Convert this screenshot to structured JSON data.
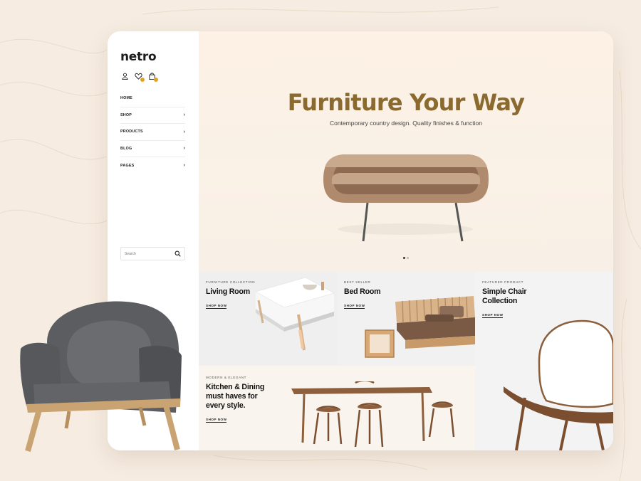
{
  "brand": {
    "logo": "netro"
  },
  "header_icons": [
    "user-icon",
    "heart-icon",
    "bag-icon"
  ],
  "nav": {
    "items": [
      {
        "label": "HOME",
        "has_submenu": false
      },
      {
        "label": "SHOP",
        "has_submenu": true
      },
      {
        "label": "PRODUCTS",
        "has_submenu": true
      },
      {
        "label": "BLOG",
        "has_submenu": true
      },
      {
        "label": "PAGES",
        "has_submenu": true
      }
    ],
    "chevron": "›"
  },
  "search": {
    "placeholder": "Search"
  },
  "hero": {
    "title": "Furniture Your Way",
    "subtitle": "Contemporary country design. Quality finishes & function",
    "slide_count": 2,
    "active_slide": 1
  },
  "cards": [
    {
      "tag": "FURNITURE COLLECTION",
      "title": "Living Room",
      "cta": "SHOP NOW"
    },
    {
      "tag": "BEST SELLER",
      "title": "Bed Room",
      "cta": "SHOP NOW"
    },
    {
      "tag": "FEATURED PRODUCT",
      "title": "Simple Chair Collection",
      "cta": "SHOP NOW"
    },
    {
      "tag": "MODERN & ELEGANT",
      "title": "Kitchen & Dining must haves for every style.",
      "cta": "SHOP NOW"
    }
  ],
  "colors": {
    "accent": "#8a6a2e",
    "background": "#f6ece1",
    "hero_bg": "#fcf1e4",
    "badge": "#e3a128"
  }
}
